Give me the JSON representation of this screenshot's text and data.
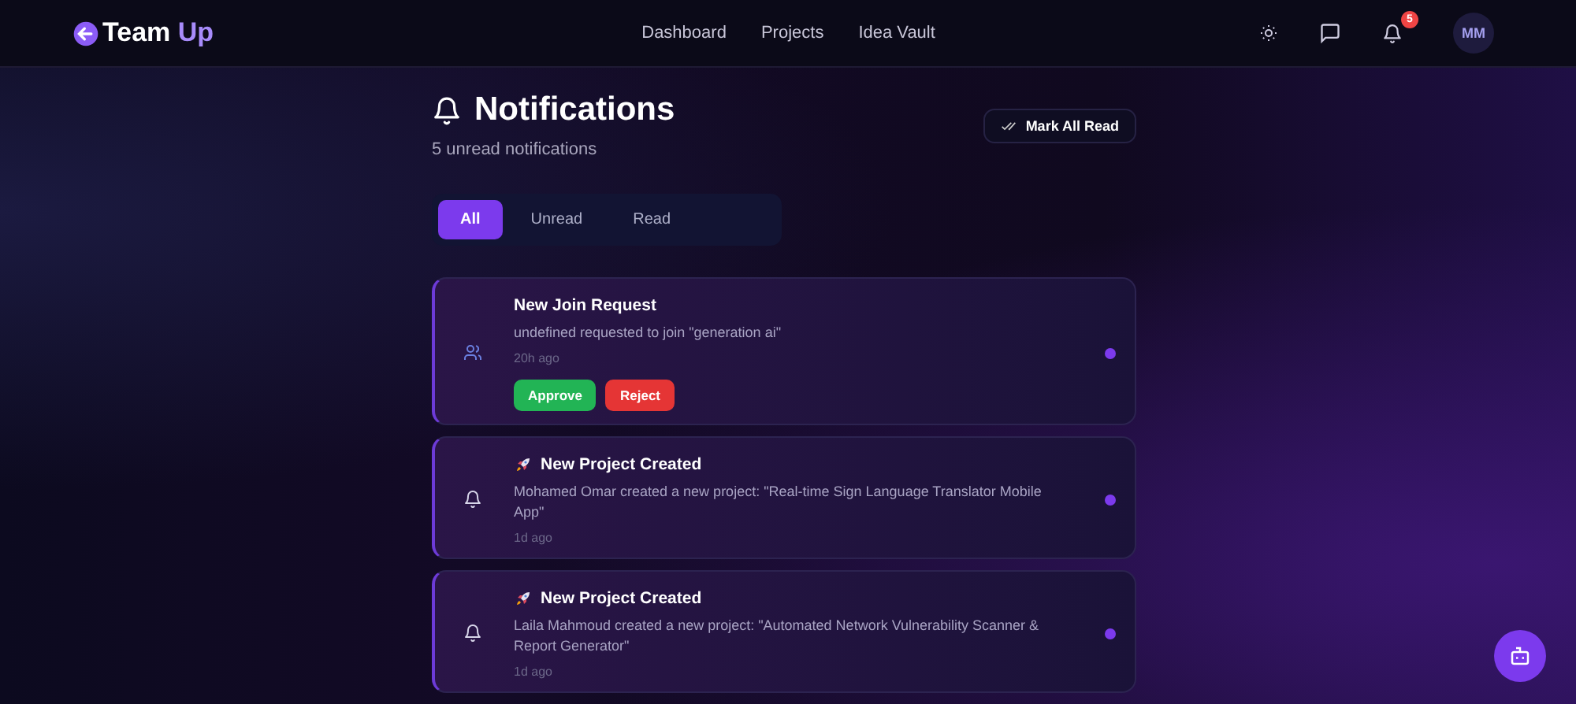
{
  "header": {
    "logo": "Team",
    "logo_accent": "Up",
    "nav": [
      {
        "label": "Dashboard"
      },
      {
        "label": "Projects"
      },
      {
        "label": "Idea Vault"
      }
    ],
    "notification_count": "5",
    "avatar": "MM"
  },
  "page": {
    "title": "Notifications",
    "subtitle": "5 unread notifications",
    "mark_all": "Mark All Read"
  },
  "tabs": [
    {
      "label": "All",
      "selected": true
    },
    {
      "label": "Unread",
      "selected": false
    },
    {
      "label": "Read",
      "selected": false
    }
  ],
  "notifications": [
    {
      "kind": "join",
      "title": "New Join Request",
      "message": "undefined requested to join \"generation ai\"",
      "time": "20h ago",
      "unread": true,
      "actions": [
        "Approve",
        "Reject"
      ]
    },
    {
      "kind": "project",
      "title": "New Project Created",
      "message": "Mohamed Omar created a new project: \"Real-time Sign Language Translator Mobile App\"",
      "time": "1d ago",
      "unread": true
    },
    {
      "kind": "project",
      "title": "New Project Created",
      "message": "Laila Mahmoud created a new project: \"Automated Network Vulnerability Scanner & Report Generator\"",
      "time": "1d ago",
      "unread": true
    }
  ]
}
